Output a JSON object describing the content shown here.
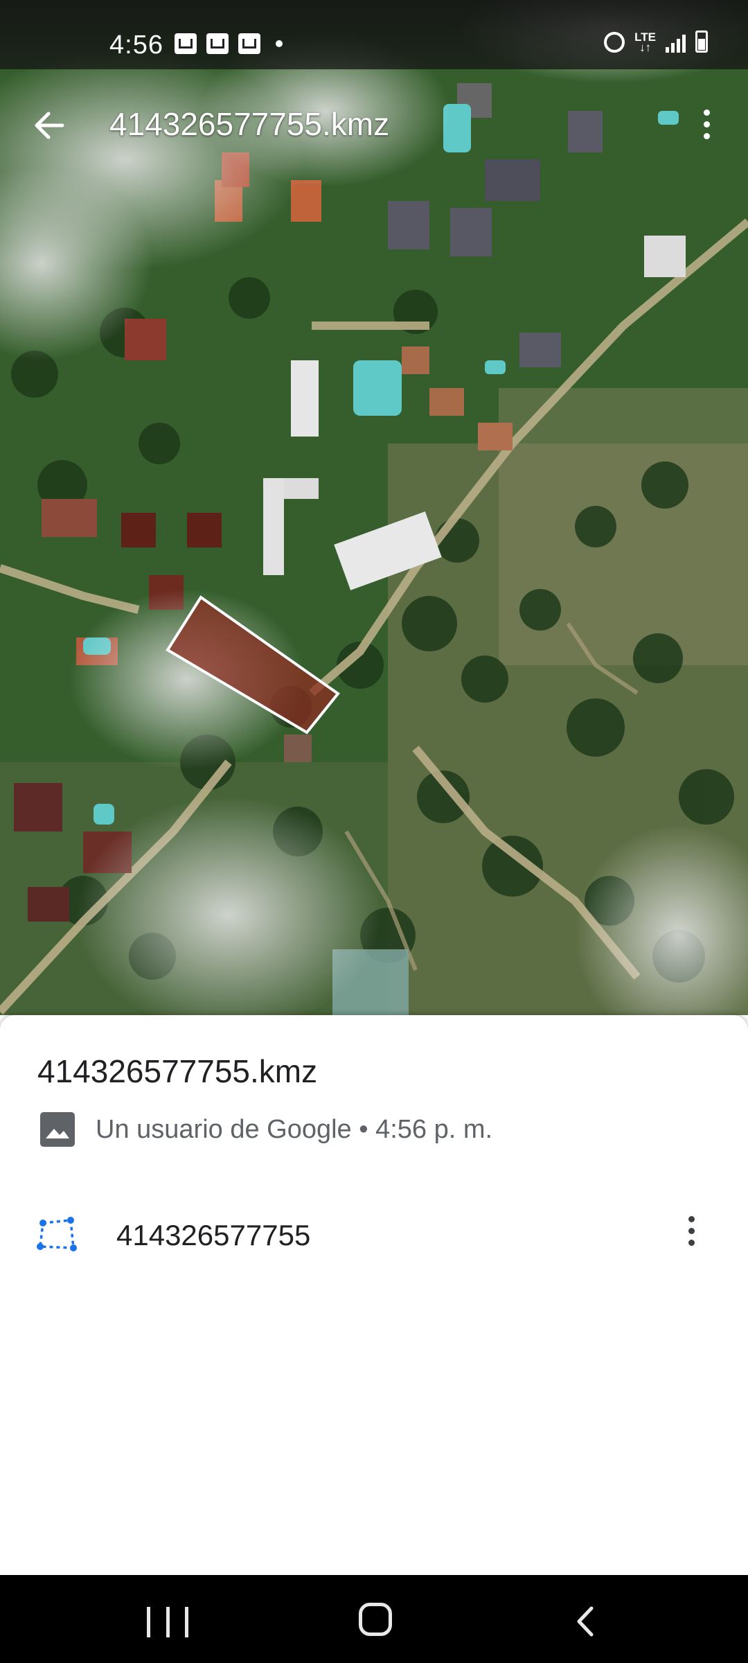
{
  "status_bar": {
    "time": "4:56",
    "left_icons": [
      "gallery-icon",
      "app-icon",
      "app-icon"
    ],
    "network": "LTE"
  },
  "app_bar": {
    "title": "414326577755.kmz",
    "back_icon": "arrow-left-icon",
    "more_icon": "more-vert-icon"
  },
  "map": {
    "highlight_color": "#8b2e22",
    "outline_color": "#ffffff"
  },
  "sheet": {
    "title": "414326577755.kmz",
    "meta": "Un usuario de Google • 4:56 p. m.",
    "meta_icon": "image-icon",
    "items": [
      {
        "label": "414326577755",
        "icon": "polygon-icon"
      }
    ]
  },
  "nav_bar": {
    "buttons": [
      "recents",
      "home",
      "back"
    ]
  }
}
